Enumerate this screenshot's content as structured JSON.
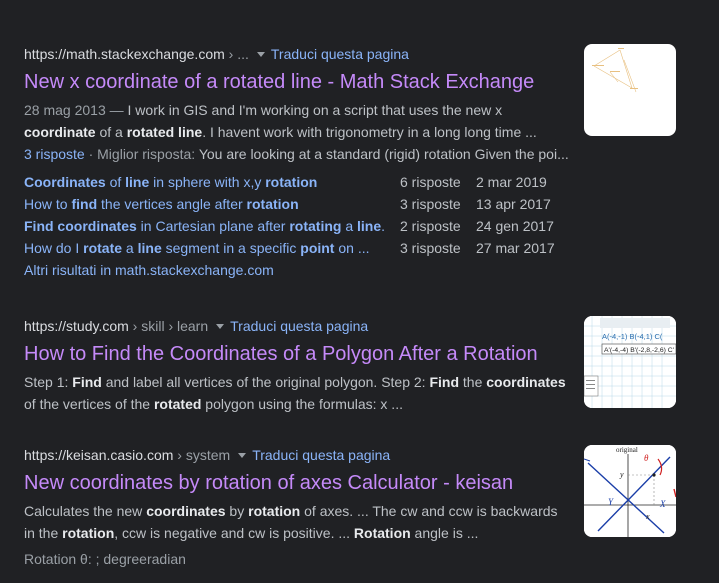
{
  "results": [
    {
      "domain": "https://math.stackexchange.com",
      "path": " › ...",
      "translate": "Traduci questa pagina",
      "title": "New x coordinate of a rotated line - Math Stack Exchange",
      "snippet": {
        "date": "28 mag 2013 — ",
        "p1": "I work in GIS and I'm working on a script that uses the new x ",
        "b1": "coordinate",
        "p2": " of a ",
        "b2": "rotated line",
        "p3": ". I havent work with trigonometry in a long long time ..."
      },
      "answers_link": "3 risposte",
      "best_label": " · Miglior risposta: ",
      "best_text": "You are looking at a standard (rigid) rotation Given the poi...",
      "sitelinks": [
        {
          "parts": [
            [
              "b",
              "Coordinates"
            ],
            [
              "n",
              " of "
            ],
            [
              "b",
              "line"
            ],
            [
              "n",
              " in sphere with x,y "
            ],
            [
              "b",
              "rotation"
            ]
          ],
          "count": "6 risposte",
          "date": "2 mar 2019"
        },
        {
          "parts": [
            [
              "n",
              "How to "
            ],
            [
              "b",
              "find"
            ],
            [
              "n",
              " the vertices angle after "
            ],
            [
              "b",
              "rotation"
            ]
          ],
          "count": "3 risposte",
          "date": "13 apr 2017"
        },
        {
          "parts": [
            [
              "b",
              "Find coordinates"
            ],
            [
              "n",
              " in Cartesian plane after "
            ],
            [
              "b",
              "rotating"
            ],
            [
              "n",
              " a "
            ],
            [
              "b",
              "line"
            ],
            [
              "n",
              "."
            ]
          ],
          "count": "2 risposte",
          "date": "24 gen 2017"
        },
        {
          "parts": [
            [
              "n",
              "How do I "
            ],
            [
              "b",
              "rotate"
            ],
            [
              "n",
              " a "
            ],
            [
              "b",
              "line"
            ],
            [
              "n",
              " segment in a specific "
            ],
            [
              "b",
              "point"
            ],
            [
              "n",
              " on ..."
            ]
          ],
          "count": "3 risposte",
          "date": "27 mar 2017"
        }
      ],
      "more": "Altri risultati in math.stackexchange.com"
    },
    {
      "domain": "https://study.com",
      "path": " › skill › learn",
      "translate": "Traduci questa pagina",
      "title": "How to Find the Coordinates of a Polygon After a Rotation",
      "snippet": {
        "p0": "Step 1: ",
        "b0": "Find",
        "p1": " and label all vertices of the original polygon. Step 2: ",
        "b1": "Find",
        "p2": " the ",
        "b2": "coordinates",
        "p3": " of the vertices of the ",
        "b3": "rotated",
        "p4": " polygon using the formulas: x ..."
      },
      "thumb_text": {
        "l1": "A(-4,-1) B(-4,1) C(",
        "l2": "A'(-4,-4) B'(-2,8,-2,6) C'"
      }
    },
    {
      "domain": "https://keisan.casio.com",
      "path": " › system",
      "translate": "Traduci questa pagina",
      "title": "New coordinates by rotation of axes Calculator - keisan",
      "snippet": {
        "p0": "Calculates the new ",
        "b0": "coordinates",
        "p1": " by ",
        "b1": "rotation",
        "p2": " of axes. ... The cw and ccw is backwards in the ",
        "b2": "rotation",
        "p3": ", ccw is negative and cw is positive. ... ",
        "b3": "Rotation",
        "p4": " angle is ..."
      },
      "footer": "Rotation θ: ; degreeradian",
      "thumb_text": {
        "original": "original",
        "theta": "θ",
        "y": "y",
        "x": "x",
        "Y": "Y",
        "X": "X"
      }
    }
  ],
  "colors": {
    "background": "#202124",
    "title": "#c58af9",
    "link": "#8ab4f8",
    "text": "#bdc1c6"
  }
}
